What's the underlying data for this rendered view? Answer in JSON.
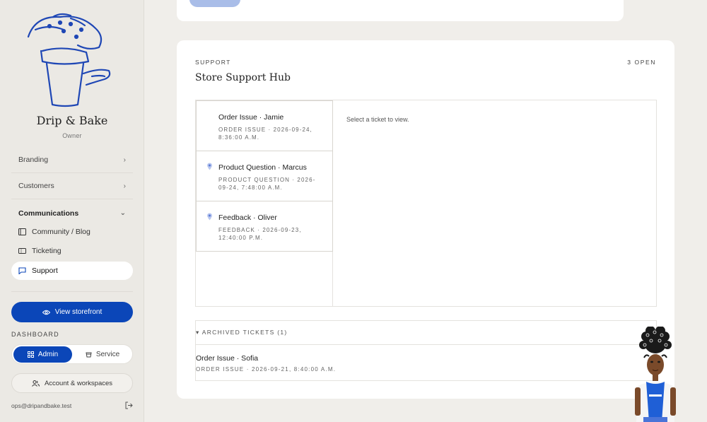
{
  "sidebar": {
    "brand_name": "Drip & Bake",
    "brand_role": "Owner",
    "nav": [
      {
        "label": "Branding"
      },
      {
        "label": "Customers"
      },
      {
        "label": "Communications"
      }
    ],
    "sub_items": [
      {
        "label": "Community / Blog",
        "icon": "book-icon"
      },
      {
        "label": "Ticketing",
        "icon": "ticket-icon"
      },
      {
        "label": "Support",
        "icon": "chat-icon",
        "active": true
      }
    ],
    "view_storefront": "View storefront",
    "dashboard_label": "DASHBOARD",
    "mode_admin": "Admin",
    "mode_service": "Service",
    "account_label": "Account & workspaces",
    "email": "ops@dripandbake.test"
  },
  "support": {
    "eyebrow": "SUPPORT",
    "open_count": "3 OPEN",
    "title": "Store Support Hub",
    "empty_detail": "Select a ticket to view.",
    "tickets": [
      {
        "title": "Order Issue · Jamie",
        "meta": "ORDER ISSUE · 2026-09-24, 8:36:00 A.M.",
        "has_avatar": false
      },
      {
        "title": "Product Question · Marcus",
        "meta": "PRODUCT QUESTION · 2026-09-24, 7:48:00 A.M.",
        "has_avatar": true
      },
      {
        "title": "Feedback · Oliver",
        "meta": "FEEDBACK · 2026-09-23, 12:40:00 P.M.",
        "has_avatar": true
      }
    ],
    "archived_label": "▾ ARCHIVED TICKETS (1)",
    "archived": [
      {
        "title": "Order Issue · Sofia",
        "meta": "ORDER ISSUE · 2026-09-21, 8:40:00 A.M."
      }
    ]
  },
  "colors": {
    "accent": "#0b46b8",
    "sidebar_bg": "#ebe9e4",
    "page_bg": "#f0eeea"
  }
}
